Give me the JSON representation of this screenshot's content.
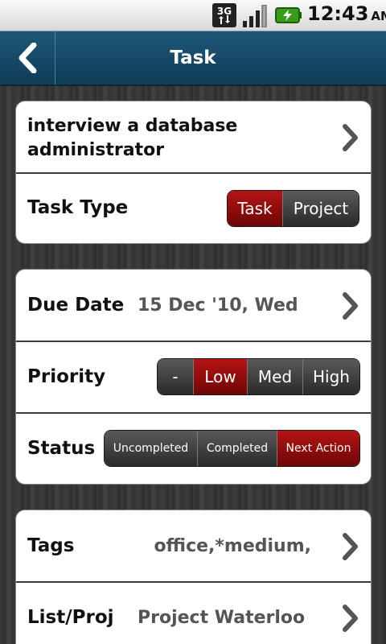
{
  "status_bar": {
    "network": "3G",
    "time": "12:43",
    "ampm": "AM"
  },
  "header": {
    "title": "Task",
    "back_icon": "chevron-left-icon"
  },
  "task": {
    "title": "interview a database administrator",
    "type_label": "Task Type",
    "type_options": [
      "Task",
      "Project"
    ],
    "type_selected": "Task"
  },
  "details": {
    "due_label": "Due Date",
    "due_value": "15 Dec '10, Wed",
    "priority_label": "Priority",
    "priority_options": [
      "-",
      "Low",
      "Med",
      "High"
    ],
    "priority_selected": "Low",
    "status_label": "Status",
    "status_options": [
      "Uncompleted",
      "Completed",
      "Next Action"
    ],
    "status_selected": "Next Action"
  },
  "meta": {
    "tags_label": "Tags",
    "tags_value": "office,*medium,",
    "list_label": "List/Proj",
    "list_value": "Project Waterloo"
  },
  "colors": {
    "header": "#1e5878",
    "selected": "#a00f0f",
    "segment": "#3a3a3a"
  }
}
